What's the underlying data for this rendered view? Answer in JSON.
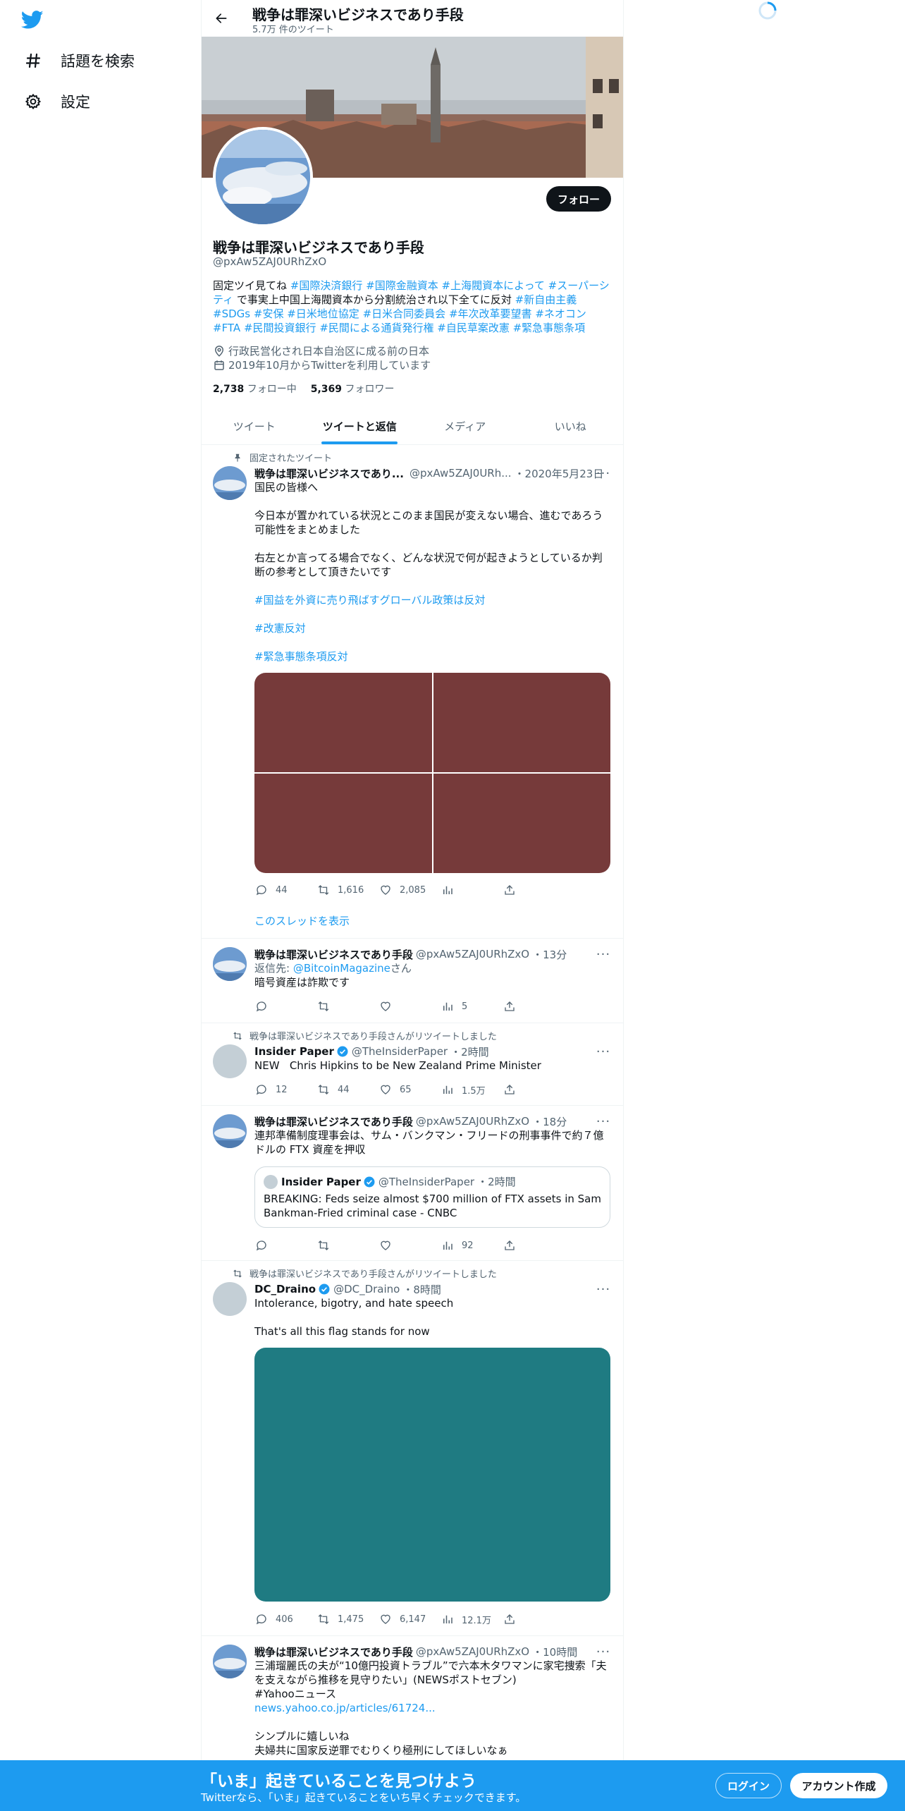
{
  "sidebar": {
    "logo_icon": "twitter-bird-icon",
    "items": [
      {
        "label": "話題を検索",
        "icon": "hashtag-icon"
      },
      {
        "label": "設定",
        "icon": "gear-icon"
      }
    ]
  },
  "header": {
    "title": "戦争は罪深いビジネスであり手段",
    "tweet_count": "5.7万 件のツイート"
  },
  "profile": {
    "name": "戦争は罪深いビジネスであり手段",
    "handle": "@pxAw5ZAJ0URhZxO",
    "follow_label": "フォロー",
    "bio_prefix": "固定ツイ見てね ",
    "bio_tags_1": [
      "#国際決済銀行",
      "#国際金融資本",
      "#上海閥資本によって",
      "#スーパーシティ"
    ],
    "bio_middle": " で事実上中国上海閥資本から分割統治され以下全てに反対 ",
    "bio_tags_2": [
      "#新自由主義",
      "#SDGs",
      "#安保",
      "#日米地位協定",
      "#日米合同委員会",
      "#年次改革要望書",
      "#ネオコン",
      "#FTA",
      "#民間投資銀行",
      "#民間による通貨発行権",
      "#自民草案改憲",
      "#緊急事態条項"
    ],
    "location": "行政民営化され日本自治区に成る前の日本",
    "joined": "2019年10月からTwitterを利用しています",
    "following_count": "2,738",
    "following_label": "フォロー中",
    "followers_count": "5,369",
    "followers_label": "フォロワー"
  },
  "tabs": [
    {
      "label": "ツイート",
      "active": false
    },
    {
      "label": "ツイートと返信",
      "active": true
    },
    {
      "label": "メディア",
      "active": false
    },
    {
      "label": "いいね",
      "active": false
    }
  ],
  "tweets": [
    {
      "context": "固定されたツイート",
      "name": "戦争は罪深いビジネスであり...",
      "handle": "@pxAw5ZAJ0URh...",
      "time": "・2020年5月23日",
      "lines": [
        "国民の皆様へ",
        "今日本が置かれている状況とこのまま国民が変えない場合、進むであろう可能性をまとめました",
        "右左とか言ってる場合でなく、どんな状況で何が起きようとしているか判断の参考として頂きたいです"
      ],
      "tags": [
        "#国益を外資に売り飛ばすグローバル政策は反対",
        "#改憲反対",
        "#緊急事態条項反対"
      ],
      "replies": "44",
      "retweets": "1,616",
      "likes": "2,085",
      "thread_link": "このスレッドを表示"
    },
    {
      "name": "戦争は罪深いビジネスであり手段",
      "handle": "@pxAw5ZAJ0URhZxO",
      "time": "・13分",
      "reply_to_prefix": "返信先: ",
      "reply_to_user": "@BitcoinMagazine",
      "reply_to_suffix": "さん",
      "text": "暗号資産は詐欺です",
      "views": "5"
    },
    {
      "context": "戦争は罪深いビジネスであり手段さんがリツイートしました",
      "name": "Insider Paper",
      "handle": "@TheInsiderPaper",
      "time": "・2時間",
      "text": "NEW   Chris Hipkins to be New Zealand Prime Minister",
      "replies": "12",
      "retweets": "44",
      "likes": "65",
      "views": "1.5万"
    },
    {
      "name": "戦争は罪深いビジネスであり手段",
      "handle": "@pxAw5ZAJ0URhZxO",
      "time": "・18分",
      "text": "連邦準備制度理事会は、サム・バンクマン・フリードの刑事事件で約７億ドルの FTX 資産を押収",
      "quote": {
        "name": "Insider Paper",
        "handle": "@TheInsiderPaper",
        "time": "・2時間",
        "text": "BREAKING: Feds seize almost $700 million of FTX assets in Sam Bankman-Fried criminal case - CNBC"
      },
      "views": "92"
    },
    {
      "context": "戦争は罪深いビジネスであり手段さんがリツイートしました",
      "name": "DC_Draino",
      "handle": "@DC_Draino",
      "time": "・8時間",
      "line1": "Intolerance, bigotry, and hate speech",
      "line2": "That's all this flag stands for now",
      "replies": "406",
      "retweets": "1,475",
      "likes": "6,147",
      "views": "12.1万"
    },
    {
      "name": "戦争は罪深いビジネスであり手段",
      "handle": "@pxAw5ZAJ0URhZxO",
      "time": "・10時間",
      "text": "三浦瑠麗氏の夫が“10億円投資トラブル”で六本木タワマンに家宅捜索「夫を支えながら推移を見守りたい」(NEWSポストセブン)",
      "tag": "#Yahooニュース",
      "link": "news.yahoo.co.jp/articles/61724...",
      "after1": "シンプルに嬉しいね",
      "after2": "夫婦共に国家反逆罪でむりくり極刑にしてほしいなぁ"
    }
  ],
  "bottom_bar": {
    "title": "「いま」起きていることを見つけよう",
    "subtitle": "Twitterなら、「いま」起きていることをいち早くチェックできます。",
    "login_label": "ログイン",
    "signup_label": "アカウント作成"
  }
}
